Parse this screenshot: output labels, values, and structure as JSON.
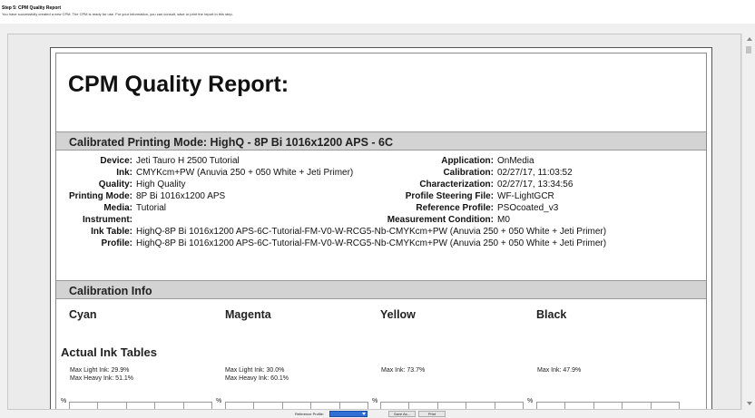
{
  "step": {
    "title": "Step 5: CPM Quality Report",
    "description": "You have successfully created a new CPM. The CPM is ready for use. For your information, you can consult, save or print the report in this step."
  },
  "report": {
    "title": "CPM Quality Report:",
    "mode_header": "Calibrated Printing Mode: HighQ - 8P Bi 1016x1200 APS - 6C",
    "left_fields": [
      {
        "label": "Device:",
        "value": "Jeti Tauro H 2500 Tutorial"
      },
      {
        "label": "Ink:",
        "value": "CMYKcm+PW (Anuvia 250 + 050 White + Jeti Primer)"
      },
      {
        "label": "Quality:",
        "value": "High Quality"
      },
      {
        "label": "Printing Mode:",
        "value": "8P Bi 1016x1200 APS"
      },
      {
        "label": "Media:",
        "value": "Tutorial"
      },
      {
        "label": "Instrument:",
        "value": ""
      }
    ],
    "right_fields": [
      {
        "label": "Application:",
        "value": "OnMedia"
      },
      {
        "label": "Calibration:",
        "value": "02/27/17, 11:03:52"
      },
      {
        "label": "Characterization:",
        "value": "02/27/17, 13:34:56"
      },
      {
        "label": "Profile Steering File:",
        "value": "WF-LightGCR"
      },
      {
        "label": "Reference Profile:",
        "value": "PSOcoated_v3"
      },
      {
        "label": "Measurement Condition:",
        "value": "M0"
      }
    ],
    "ink_table": {
      "label": "Ink Table:",
      "value": "HighQ-8P Bi 1016x1200 APS-6C-Tutorial-FM-V0-W-RCG5-Nb-CMYKcm+PW (Anuvia 250 + 050 White + Jeti Primer)"
    },
    "profile": {
      "label": "Profile:",
      "value": "HighQ-8P Bi 1016x1200 APS-6C-Tutorial-FM-V0-W-RCG5-Nb-CMYKcm+PW (Anuvia 250 + 050 White + Jeti Primer)"
    },
    "calibration_header": "Calibration Info",
    "inks": [
      "Cyan",
      "Magenta",
      "Yellow",
      "Black"
    ],
    "actual_ink_tables_title": "Actual Ink Tables",
    "max_ink": [
      {
        "light": "Max Light Ink: 29.9%",
        "heavy": "Max Heavy Ink: 51.1%"
      },
      {
        "light": "Max Light Ink: 30.0%",
        "heavy": "Max Heavy Ink: 60.1%"
      },
      {
        "light": "Max Ink: 73.7%",
        "heavy": ""
      },
      {
        "light": "Max Ink: 47.9%",
        "heavy": ""
      }
    ],
    "grid_unit": "%"
  },
  "toolbar": {
    "reference_profile_label": "Reference Profile:",
    "reference_profile_value": "",
    "save_as_label": "Save As...",
    "print_label": "Print"
  },
  "colors": {
    "section_bar": "#d3d3d3",
    "select_highlight": "#2f6fd6"
  }
}
